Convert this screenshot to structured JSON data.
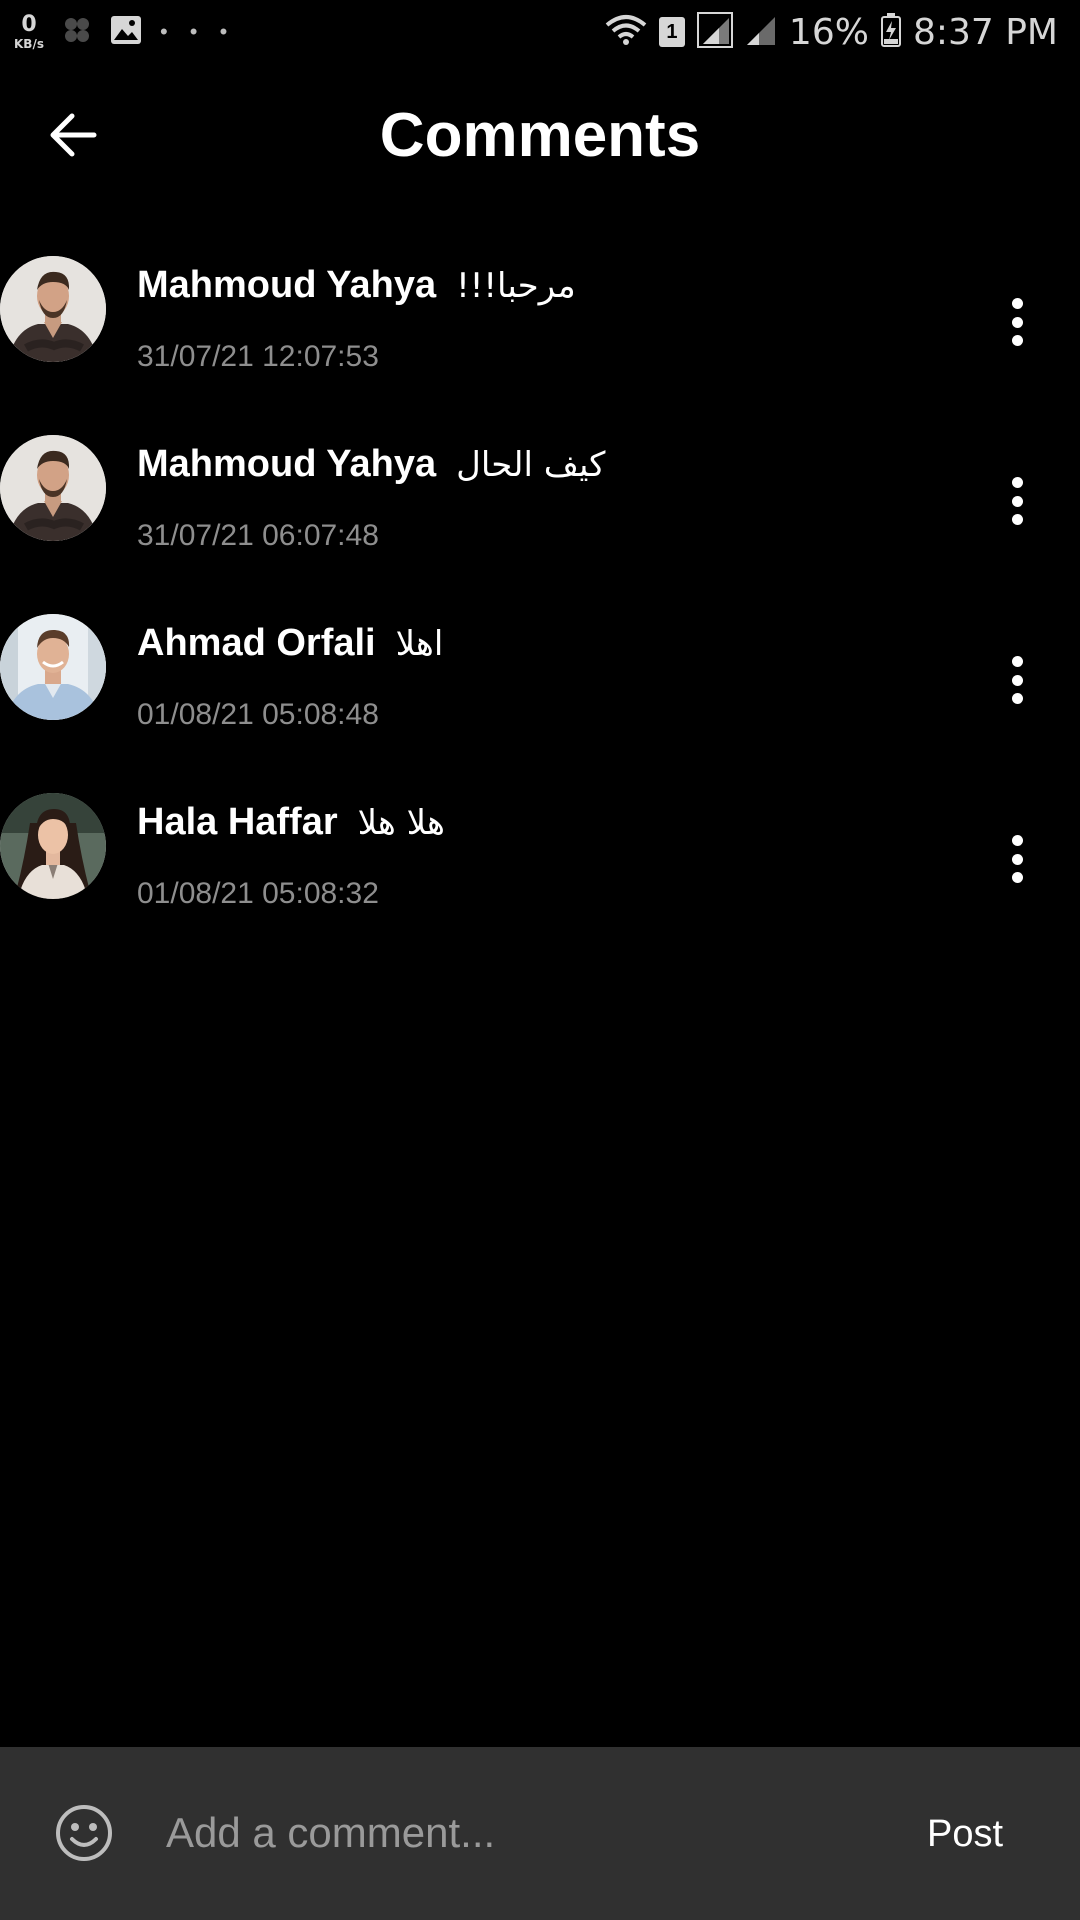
{
  "status_bar": {
    "net_speed_value": "0",
    "net_speed_unit": "KB/s",
    "notification_dots": "• • •",
    "sim_slot": "1",
    "battery_percent": "16%",
    "time": "8:37 PM"
  },
  "header": {
    "title": "Comments",
    "back_icon": "arrow-left-icon"
  },
  "comments": [
    {
      "author": "Mahmoud Yahya",
      "text": "مرحبا!!!",
      "timestamp": "31/07/21 12:07:53"
    },
    {
      "author": "Mahmoud Yahya",
      "text": "كيف الحال",
      "timestamp": "31/07/21 06:07:48"
    },
    {
      "author": "Ahmad Orfali",
      "text": "اهلا",
      "timestamp": "01/08/21 05:08:48"
    },
    {
      "author": "Hala Haffar",
      "text": "هلا هلا",
      "timestamp": "01/08/21 05:08:32"
    }
  ],
  "composer": {
    "placeholder": "Add a comment...",
    "value": "",
    "post_label": "Post",
    "emoji_icon": "smiley-icon"
  },
  "colors": {
    "background": "#000000",
    "composer_background": "#303030",
    "timestamp": "#8e8e8e",
    "placeholder": "#9a9a9a"
  }
}
